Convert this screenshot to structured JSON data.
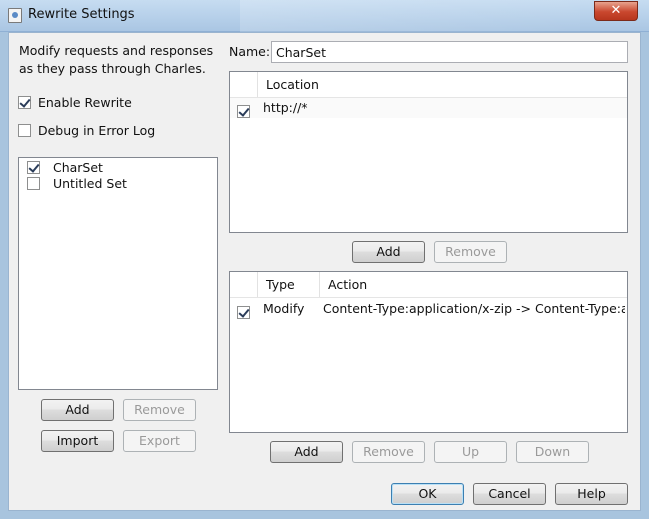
{
  "window": {
    "title": "Rewrite Settings",
    "close_glyph": "✕"
  },
  "intro_text_line1": "Modify requests and responses",
  "intro_text_line2": "as they pass through Charles.",
  "enable_rewrite": {
    "label": "Enable Rewrite",
    "checked": true
  },
  "debug_log": {
    "label": "Debug in Error Log",
    "checked": false
  },
  "sets": [
    {
      "label": "CharSet",
      "checked": true
    },
    {
      "label": "Untitled Set",
      "checked": false
    }
  ],
  "set_buttons": {
    "add": "Add",
    "remove": "Remove",
    "import": "Import",
    "export": "Export"
  },
  "name": {
    "label": "Name:",
    "value": "CharSet"
  },
  "locations": {
    "header": "Location",
    "rows": [
      {
        "checked": true,
        "location": "http://*"
      }
    ],
    "add": "Add",
    "remove": "Remove"
  },
  "rules": {
    "headers": {
      "type": "Type",
      "action": "Action"
    },
    "rows": [
      {
        "checked": true,
        "type": "Modify",
        "action": "Content-Type:application/x-zip -> Content-Type:a..."
      }
    ],
    "add": "Add",
    "remove": "Remove",
    "up": "Up",
    "down": "Down"
  },
  "dialog_buttons": {
    "ok": "OK",
    "cancel": "Cancel",
    "help": "Help"
  }
}
